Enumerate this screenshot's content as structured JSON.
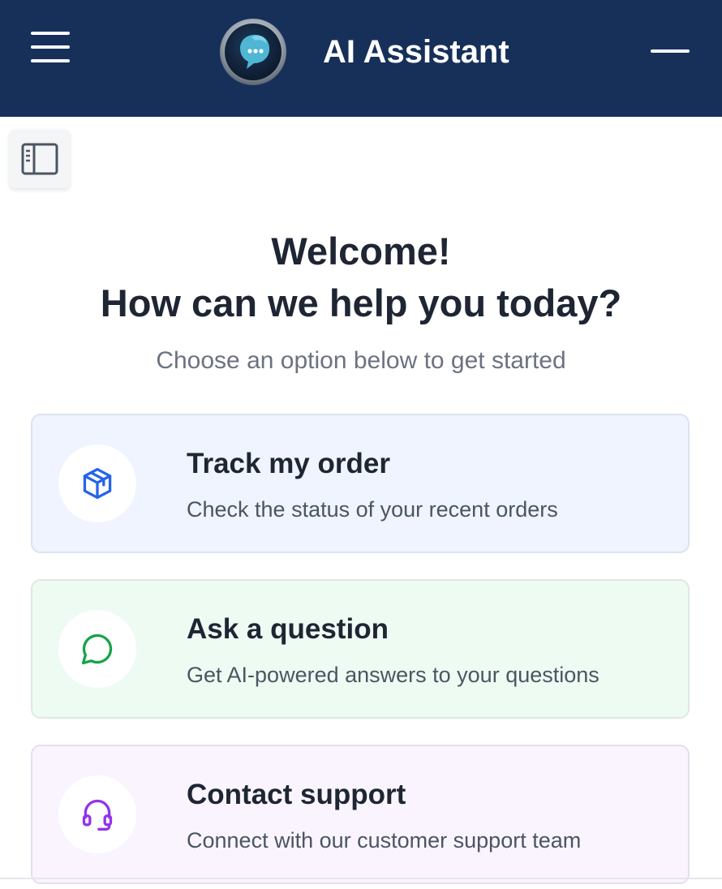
{
  "header": {
    "title": "AI Assistant",
    "menu_icon": "hamburger-menu-icon",
    "logo_icon": "chat-bubble-logo-icon",
    "minimize_icon": "minimize-icon",
    "background_color": "#16305a"
  },
  "sidebar_toggle": {
    "icon": "sidebar-panel-icon"
  },
  "main": {
    "welcome_line1": "Welcome!",
    "welcome_line2": "How can we help you today?",
    "subtitle": "Choose an option below to get started",
    "options": [
      {
        "title": "Track my order",
        "description": "Check the status of your recent orders",
        "icon": "package-box-icon",
        "accent_color": "#2563eb",
        "background_color": "#eff4fe"
      },
      {
        "title": "Ask a question",
        "description": "Get AI-powered answers to your questions",
        "icon": "message-circle-icon",
        "accent_color": "#16a34a",
        "background_color": "#eefbf2"
      },
      {
        "title": "Contact support",
        "description": "Connect with our customer support team",
        "icon": "headset-icon",
        "accent_color": "#9333ea",
        "background_color": "#f9f4fe"
      }
    ]
  }
}
